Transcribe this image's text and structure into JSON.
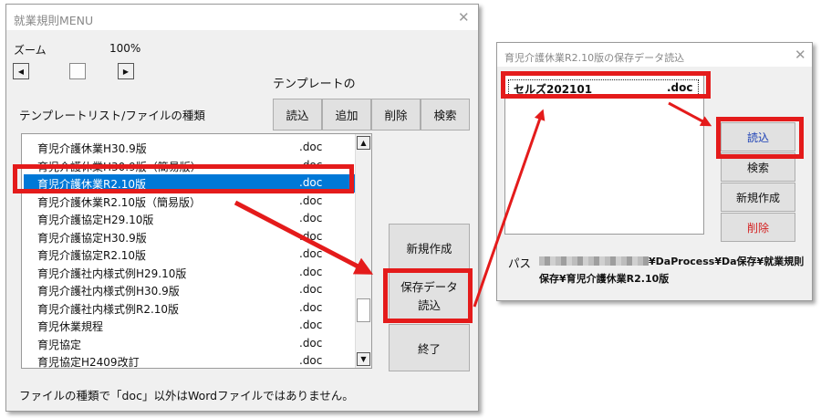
{
  "menu_dialog": {
    "title": "就業規則MENU",
    "zoom_label": "ズーム",
    "zoom_value": "100%",
    "zoom_level_pct": 100,
    "template_header": "テンプレートの",
    "list_label": "テンプレートリスト/ファイルの種類",
    "buttons": {
      "load": "読込",
      "add": "追加",
      "delete": "削除",
      "search": "検索"
    },
    "template_list": [
      {
        "name": "育児介護休業H30.9版",
        "ext": ".doc"
      },
      {
        "name": "育児介護休業H30.9版（簡易版）",
        "ext": ".doc"
      },
      {
        "name": "育児介護休業R2.10版",
        "ext": ".doc",
        "selected": true
      },
      {
        "name": "育児介護休業R2.10版（簡易版）",
        "ext": ".doc"
      },
      {
        "name": "育児介護協定H29.10版",
        "ext": ".doc"
      },
      {
        "name": "育児介護協定H30.9版",
        "ext": ".doc"
      },
      {
        "name": "育児介護協定R2.10版",
        "ext": ".doc"
      },
      {
        "name": "育児介護社内様式例H29.10版",
        "ext": ".doc"
      },
      {
        "name": "育児介護社内様式例H30.9版",
        "ext": ".doc"
      },
      {
        "name": "育児介護社内様式例R2.10版",
        "ext": ".doc"
      },
      {
        "name": "育児休業規程",
        "ext": ".doc"
      },
      {
        "name": "育児協定",
        "ext": ".doc"
      },
      {
        "name": "育児協定H2409改訂",
        "ext": ".doc"
      }
    ],
    "side_buttons": {
      "new": "新規作成",
      "load_saved": "保存データ\n読込",
      "exit": "終了"
    },
    "footer_note": "ファイルの種類で「doc」以外はWordファイルではありません。"
  },
  "saved_dialog": {
    "title": "育児介護休業R2.10版の保存データ読込",
    "saved_items": [
      {
        "name": "セルズ202101",
        "ext": ".doc"
      }
    ],
    "buttons": {
      "load": "読込",
      "search": "検索",
      "new": "新規作成",
      "delete": "削除"
    },
    "path_label": "パス",
    "path_line1": "¥DaProcess¥Da保存¥就業規則",
    "path_line2": "保存¥育児介護休業R2.10版"
  },
  "colors": {
    "highlight": "#e41b1b",
    "selection": "#0078d7",
    "load_text": "#1a3fb5",
    "delete_text": "#d42020"
  }
}
